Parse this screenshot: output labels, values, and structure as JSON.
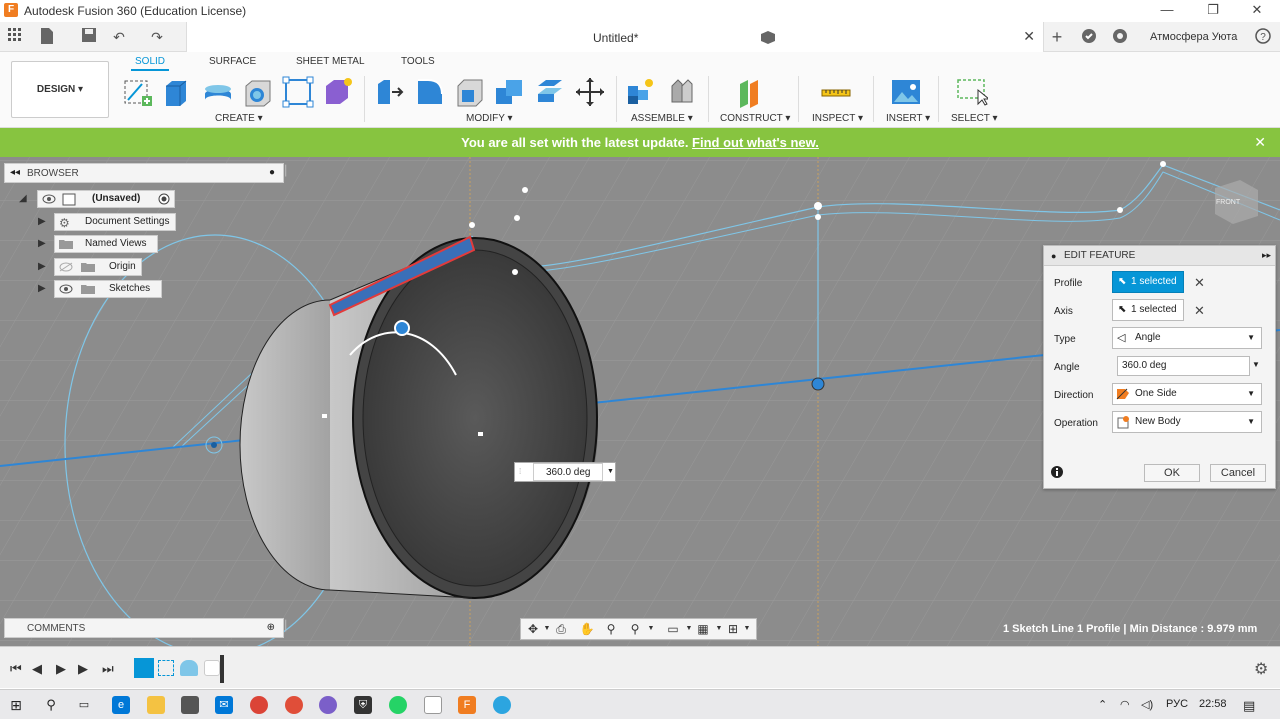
{
  "window": {
    "title": "Autodesk Fusion 360 (Education License)",
    "app_icon": "F",
    "min": "—",
    "max": "❐",
    "close": "✕"
  },
  "quick": {
    "doc_title": "Untitled*",
    "user": "Атмосфера Уюта"
  },
  "toolbar": {
    "workspace": "DESIGN ▾",
    "tabs": [
      "SOLID",
      "SURFACE",
      "SHEET METAL",
      "TOOLS"
    ],
    "groups": [
      "CREATE ▾",
      "MODIFY ▾",
      "ASSEMBLE ▾",
      "CONSTRUCT ▾",
      "INSPECT ▾",
      "INSERT ▾",
      "SELECT ▾"
    ]
  },
  "notification": {
    "text": "You are all set with the latest update. ",
    "link": "Find out what's new.",
    "close": "✕"
  },
  "browser": {
    "title": "BROWSER",
    "root": "(Unsaved)",
    "items": [
      "Document Settings",
      "Named Views",
      "Origin",
      "Sketches"
    ]
  },
  "comments": {
    "title": "COMMENTS"
  },
  "edit_feature": {
    "title": "EDIT FEATURE",
    "profile_label": "Profile",
    "profile_value": "1 selected",
    "axis_label": "Axis",
    "axis_value": "1 selected",
    "type_label": "Type",
    "type_value": "Angle",
    "angle_label": "Angle",
    "angle_value": "360.0 deg",
    "direction_label": "Direction",
    "direction_value": "One Side",
    "operation_label": "Operation",
    "operation_value": "New Body",
    "ok": "OK",
    "cancel": "Cancel"
  },
  "viewport": {
    "angle_input": "360.0 deg",
    "status": "1 Sketch Line 1 Profile | Min Distance : 9.979 mm"
  },
  "taskbar": {
    "lang": "РУС",
    "time": "22:58"
  },
  "colors": {
    "accent": "#0696d7",
    "notify": "#87c440",
    "viewport_bg": "#8c8c8c",
    "sketch_line": "#7fc6e8"
  }
}
